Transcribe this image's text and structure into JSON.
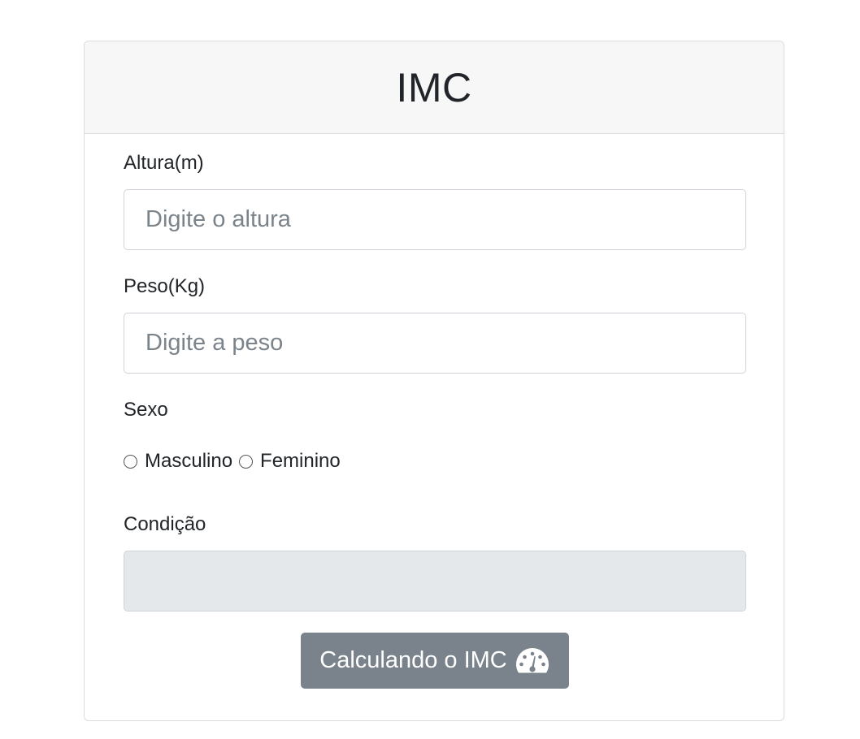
{
  "header": {
    "title": "IMC"
  },
  "form": {
    "height": {
      "label": "Altura(m)",
      "placeholder": "Digite o altura",
      "value": ""
    },
    "weight": {
      "label": "Peso(Kg)",
      "placeholder": "Digite a peso",
      "value": ""
    },
    "sex": {
      "label": "Sexo",
      "options": [
        "Masculino",
        "Feminino"
      ],
      "selected": null
    },
    "condition": {
      "label": "Condição",
      "value": ""
    },
    "submit": {
      "label": "Calculando o IMC",
      "icon": "tachometer-icon"
    }
  },
  "colors": {
    "header_bg": "#f7f7f7",
    "button_bg": "#7a838b",
    "readonly_bg": "#e4e8eb",
    "placeholder": "#7b838b"
  }
}
